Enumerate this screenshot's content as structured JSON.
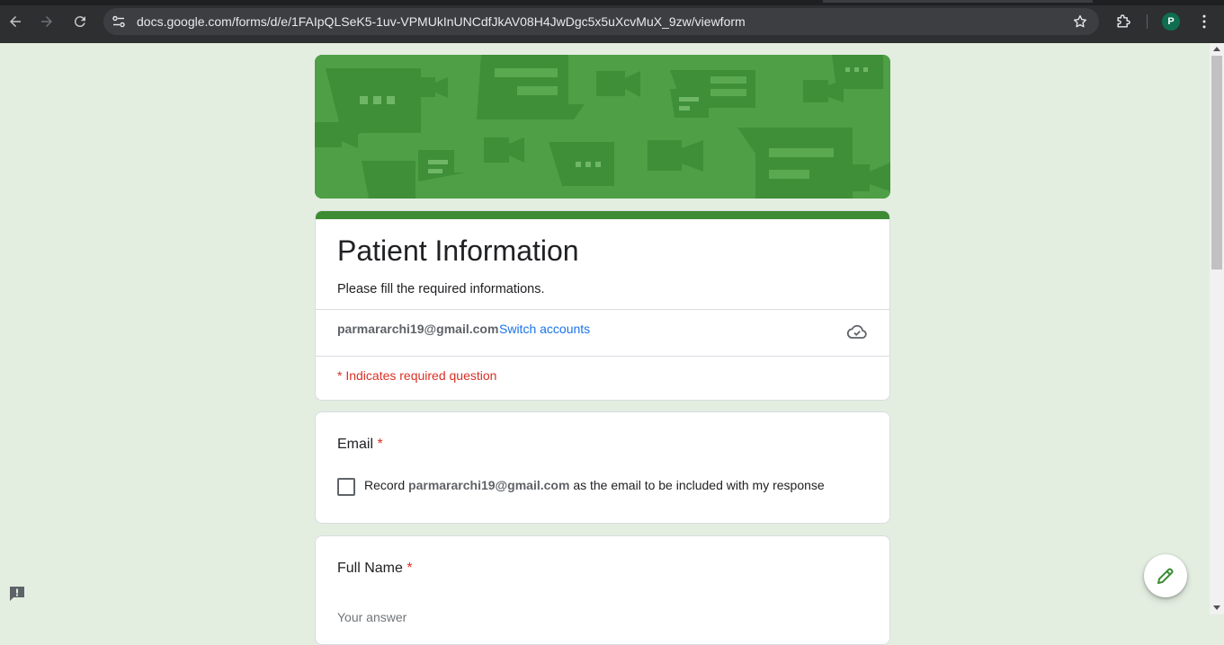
{
  "browser": {
    "url": "docs.google.com/forms/d/e/1FAIpQLSeK5-1uv-VPMUkInUNCdfJkAV08H4JwDgc5x5uXcvMuX_9zw/viewform",
    "profile_initial": "P"
  },
  "form": {
    "title": "Patient Information",
    "description": "Please fill the required informations.",
    "account_email": "parmararchi19@gmail.com",
    "switch_accounts": "Switch accounts",
    "required_note": "* Indicates required question"
  },
  "questions": [
    {
      "title": "Email",
      "required_mark": "*",
      "checkbox_prefix": "Record",
      "checkbox_email": "parmararchi19@gmail.com",
      "checkbox_suffix": "as the email to be included with my response"
    },
    {
      "title": "Full Name",
      "required_mark": "*",
      "placeholder": "Your answer"
    }
  ],
  "colors": {
    "page_bg": "#e3eee1",
    "theme": "#3d8c34",
    "link": "#1a73e8",
    "required": "#d93025"
  }
}
